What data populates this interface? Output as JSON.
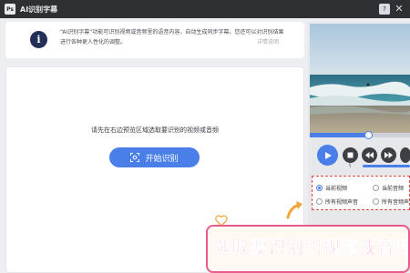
{
  "window": {
    "app_title": "AI识别字幕",
    "logo_text": "Ps",
    "help_icon": "question-icon",
    "close_icon": "close-icon"
  },
  "info": {
    "icon": "info-icon",
    "text": "“AI识别字幕”功能可识别视频或音频里的语音内容，自动生成同步字幕。您还可以对识别结果进行各种更人性化的调整。",
    "detail_link": "详情说明"
  },
  "main": {
    "hint": "请先在右边预览区域选取要识别的视频或音频",
    "start_button": "开始识别",
    "start_icon": "scan-icon"
  },
  "player": {
    "progress": 0.58,
    "volume_glyph": "(",
    "icons": [
      "play-icon",
      "stop-icon",
      "rewind-icon",
      "forward-icon"
    ]
  },
  "source_options": {
    "items": [
      {
        "label": "当前视频",
        "selected": true
      },
      {
        "label": "当前音频",
        "selected": false
      },
      {
        "label": "所有视频声音",
        "selected": false
      },
      {
        "label": "所有音频声音",
        "selected": false
      }
    ]
  },
  "annotation": {
    "banner": "选取要识别的视频或音频",
    "accent_color": "#f25a99",
    "highlight_color": "#e24b3b"
  }
}
